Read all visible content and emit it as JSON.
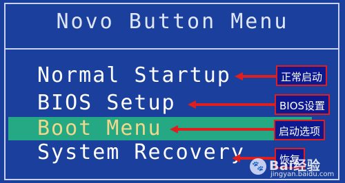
{
  "menu": {
    "title": "Novo Button Menu",
    "items": [
      {
        "label": "Normal Startup",
        "selected": false
      },
      {
        "label": "BIOS Setup",
        "selected": false
      },
      {
        "label": "Boot Menu",
        "selected": true
      },
      {
        "label": "System Recovery",
        "selected": false
      }
    ]
  },
  "annotations": [
    "正常启动",
    "BIOS设置",
    "启动选项",
    "恢复"
  ],
  "watermark": {
    "brand": "Bai经验",
    "url": "jingyan.baidu.com"
  },
  "colors": {
    "background": "#1b3f9c",
    "highlight": "#25a884",
    "selected_text": "#f0d88b",
    "annotation_bg": "#0d1a8f",
    "arrow": "#e01e1e"
  }
}
